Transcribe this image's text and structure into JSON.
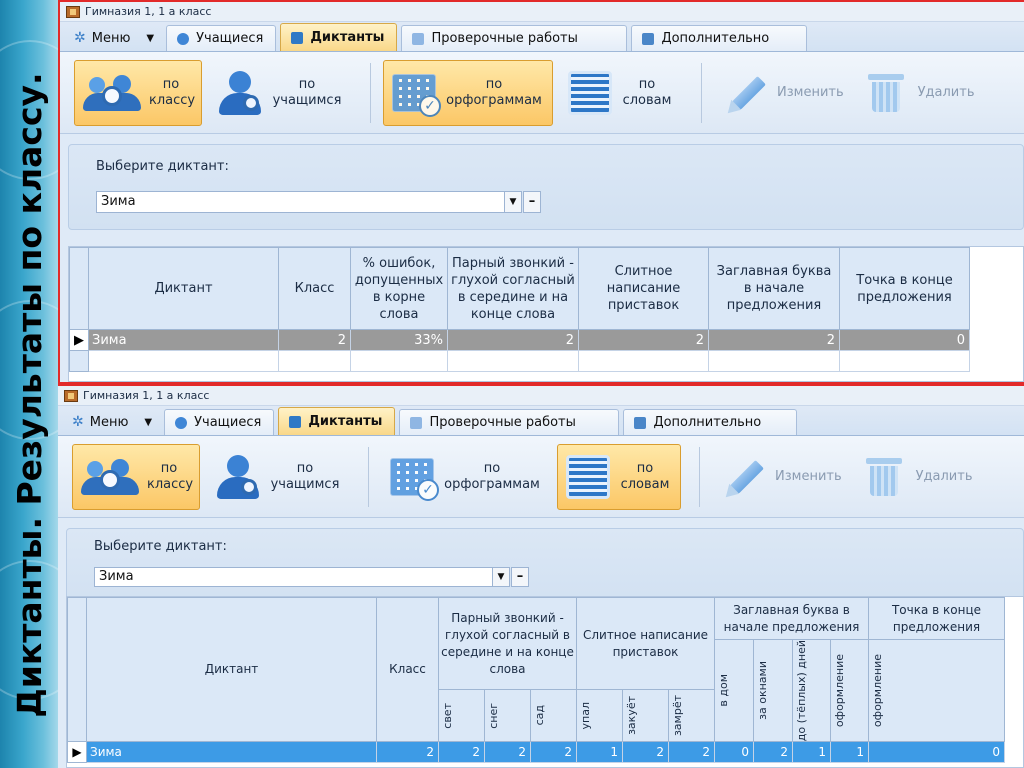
{
  "slide_title": "Диктанты. Результаты по классу.",
  "window_title": "Гимназия 1, 1 а класс",
  "menu_label": "Меню",
  "tabs": [
    "Учащиеся",
    "Диктанты",
    "Проверочные работы",
    "Дополнительно"
  ],
  "active_tab": "Диктанты",
  "ribbon": {
    "by_class": "по классу",
    "by_students": "по учащимся",
    "by_orthograms": "по орфограммам",
    "by_words": "по словам",
    "edit": "Изменить",
    "delete": "Удалить"
  },
  "selector": {
    "label": "Выберите диктант:",
    "value": "Зима",
    "remove": "–"
  },
  "colors": {
    "selected_tab": "#f9d889",
    "selected_button": "#fbc766",
    "selected_row_gray": "#9a9a9a",
    "selected_row_blue": "#3d9be6",
    "highlight_border": "#e22a2a"
  },
  "grid1": {
    "headers": [
      "Диктант",
      "Класс",
      "% ошибок, допущенных в корне слова",
      "Парный звонкий - глухой согласный в середине и на конце слова",
      "Слитное написание приставок",
      "Заглавная буква в начале предложения",
      "Точка в конце предложения"
    ],
    "rows": [
      {
        "cells": [
          "Зима",
          "2",
          "33%",
          "2",
          "2",
          "2",
          "0"
        ]
      }
    ]
  },
  "grid2": {
    "headers": {
      "dictation": "Диктант",
      "class": "Класс",
      "group_paired": "Парный звонкий - глухой согласный в середине и на конце слова",
      "group_prefix": "Слитное написание приставок",
      "group_capital": "Заглавная буква в начале предложения",
      "group_dot": "Точка в конце предложения"
    },
    "subheaders": {
      "paired": [
        "свет",
        "снег",
        "сад"
      ],
      "prefix": [
        "упал",
        "закуёт",
        "замрёт"
      ],
      "capital": [
        "в дом",
        "за окнами",
        "до (тёплых) дней",
        "оформление"
      ],
      "dot": [
        "оформление"
      ]
    },
    "rows": [
      {
        "cells": [
          "Зима",
          "2",
          "2",
          "2",
          "2",
          "1",
          "2",
          "2",
          "0",
          "2",
          "1",
          "1",
          "0"
        ]
      }
    ]
  }
}
